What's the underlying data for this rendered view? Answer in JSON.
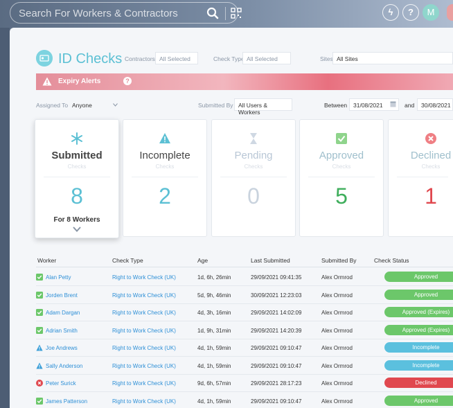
{
  "topbar": {
    "search_placeholder": "Search For Workers & Contractors",
    "icons": [
      "search-icon",
      "qr-code-icon",
      "lightning-icon",
      "help-icon"
    ],
    "help_label": "?",
    "lightning_label": "ϟ",
    "avatar_initial": "M"
  },
  "page": {
    "title": "ID Checks",
    "accent_color": "#5cc0d4"
  },
  "filters": {
    "contractors_label": "Contractors",
    "contractors_value": "All Selected",
    "check_type_label": "Check Type",
    "check_type_value": "All Selected",
    "sites_label": "Sites",
    "sites_value": "All Sites",
    "assigned_to_label": "Assigned To",
    "assigned_to_value": "Anyone",
    "submitted_by_label": "Submitted By",
    "submitted_by_value": "All Users & Workers",
    "between_label": "Between",
    "date_from": "31/08/2021",
    "and_label": "and",
    "date_to": "30/08/2021"
  },
  "alert": {
    "label": "Expiry Alerts",
    "help": "?"
  },
  "cards": [
    {
      "title": "Submitted",
      "sub": "Checks",
      "count": "8",
      "icon": "asterisk-icon",
      "color": "#5cc0d4",
      "footer": "For 8 Workers"
    },
    {
      "title": "Incomplete",
      "sub": "Checks",
      "count": "2",
      "icon": "warning-icon",
      "color": "#5cc0d4"
    },
    {
      "title": "Pending",
      "sub": "Checks",
      "count": "0",
      "icon": "hourglass-icon",
      "color": "#b9c7d6"
    },
    {
      "title": "Approved",
      "sub": "Checks",
      "count": "5",
      "icon": "check-icon",
      "color": "#6cc76a"
    },
    {
      "title": "Declined",
      "sub": "Checks",
      "count": "1",
      "icon": "x-circle-icon",
      "color": "#e0484f"
    }
  ],
  "table": {
    "headers": [
      "Worker",
      "Check Type",
      "Age",
      "Last Submitted",
      "Submitted By",
      "Check Status"
    ],
    "rows": [
      {
        "worker": "Alan Petty",
        "check": "Right to Work Check (UK)",
        "age": "1d, 6h, 26min",
        "last": "29/09/2021 09:41:35",
        "by": "Alex Ormrod",
        "status": "Approved",
        "state": "approved"
      },
      {
        "worker": "Jorden Brent",
        "check": "Right to Work Check (UK)",
        "age": "5d, 9h, 46min",
        "last": "30/09/2021 12:23:03",
        "by": "Alex Ormrod",
        "status": "Approved",
        "state": "approved"
      },
      {
        "worker": "Adam Dargan",
        "check": "Right to Work Check (UK)",
        "age": "4d, 3h, 16min",
        "last": "29/09/2021 14:02:09",
        "by": "Alex Ormrod",
        "status": "Approved (Expires)",
        "state": "approved"
      },
      {
        "worker": "Adrian Smith",
        "check": "Right to Work Check (UK)",
        "age": "1d, 9h, 31min",
        "last": "29/09/2021 14:20:39",
        "by": "Alex Ormrod",
        "status": "Approved (Expires)",
        "state": "approved"
      },
      {
        "worker": "Joe Andrews",
        "check": "Right to Work Check (UK)",
        "age": "4d, 1h, 59min",
        "last": "29/09/2021 09:10:47",
        "by": "Alex Ormrod",
        "status": "Incomplete",
        "state": "incomplete"
      },
      {
        "worker": "Sally Anderson",
        "check": "Right to Work Check (UK)",
        "age": "4d, 1h, 59min",
        "last": "29/09/2021 09:10:47",
        "by": "Alex Ormrod",
        "status": "Incomplete",
        "state": "incomplete"
      },
      {
        "worker": "Peter Surick",
        "check": "Right to Work Check (UK)",
        "age": "9d, 6h, 57min",
        "last": "29/09/2021 28:17:23",
        "by": "Alex Ormrod",
        "status": "Declined",
        "state": "declined"
      },
      {
        "worker": "James Patterson",
        "check": "Right to Work Check (UK)",
        "age": "4d, 1h, 59min",
        "last": "29/09/2021 09:10:47",
        "by": "Alex Ormrod",
        "status": "Approved",
        "state": "approved"
      }
    ]
  },
  "status_colors": {
    "approved": "#6cc76a",
    "incomplete": "#5bc0de",
    "declined": "#e0484f"
  }
}
